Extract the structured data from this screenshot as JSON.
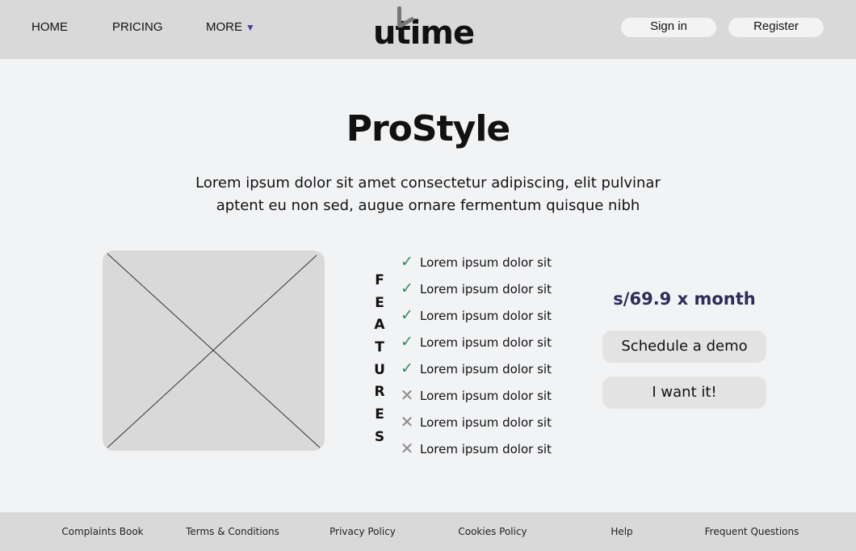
{
  "header": {
    "nav": {
      "home": "HOME",
      "pricing": "PRICING",
      "more": "MORE",
      "more_caret": "▼"
    },
    "logo": {
      "text": "utime"
    },
    "auth": {
      "sign_in": "Sign in",
      "register": "Register"
    }
  },
  "hero": {
    "title": "ProStyle",
    "subtitle_line1": "Lorem ipsum dolor sit amet consectetur adipiscing, elit pulvinar",
    "subtitle_line2": "aptent eu non sed, augue ornare fermentum quisque nibh"
  },
  "features": {
    "vertical_label": [
      "F",
      "E",
      "A",
      "T",
      "U",
      "R",
      "E",
      "S"
    ],
    "items": [
      {
        "text": "Lorem ipsum dolor sit",
        "included": true,
        "icon": "✓"
      },
      {
        "text": "Lorem ipsum dolor sit",
        "included": true,
        "icon": "✓"
      },
      {
        "text": "Lorem ipsum dolor sit",
        "included": true,
        "icon": "✓"
      },
      {
        "text": "Lorem ipsum dolor sit",
        "included": true,
        "icon": "✓"
      },
      {
        "text": "Lorem ipsum dolor sit",
        "included": true,
        "icon": "✓"
      },
      {
        "text": "Lorem ipsum dolor sit",
        "included": false,
        "icon": "✕"
      },
      {
        "text": "Lorem ipsum dolor sit",
        "included": false,
        "icon": "✕"
      },
      {
        "text": "Lorem ipsum dolor sit",
        "included": false,
        "icon": "✕"
      }
    ]
  },
  "pricing": {
    "price": "s/69.9 x month",
    "demo_button": "Schedule a demo",
    "buy_button": "I want it!"
  },
  "footer": {
    "links": [
      "Complaints Book",
      "Terms & Conditions",
      "Privacy Policy",
      "Cookies Policy",
      "Help",
      "Frequent Questions"
    ]
  },
  "colors": {
    "header_bg": "#d9d9da",
    "page_bg": "#f2f3f5",
    "check": "#2e8b57",
    "cross": "#8a8a8a",
    "price": "#2d2c5a",
    "caret": "#4a3f95"
  }
}
